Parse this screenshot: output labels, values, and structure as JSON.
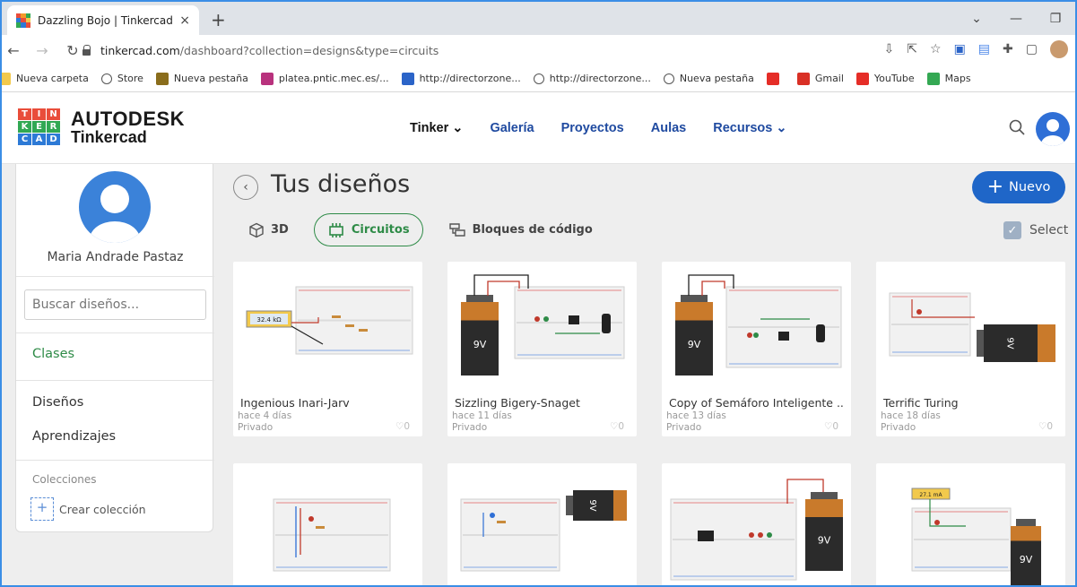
{
  "browser": {
    "tab_title": "Dazzling Bojo | Tinkercad",
    "tab_close": "×",
    "new_tab": "+",
    "url_host": "tinkercad.com",
    "url_path": "/dashboard?collection=designs&type=circuits",
    "bookmarks": [
      {
        "label": "Nueva carpeta",
        "icon": "folder-icon",
        "color": "#f2c94c"
      },
      {
        "label": "Store",
        "icon": "globe-icon",
        "color": "#555555"
      },
      {
        "label": "Nueva pestaña",
        "icon": "trophy-icon",
        "color": "#8a6d1c"
      },
      {
        "label": "platea.pntic.mec.es/...",
        "icon": "feather-icon",
        "color": "#b8327d"
      },
      {
        "label": "http://directorzone...",
        "icon": "dz-icon",
        "color": "#2b64c8"
      },
      {
        "label": "http://directorzone...",
        "icon": "globe-icon",
        "color": "#555555"
      },
      {
        "label": "Nueva pestaña",
        "icon": "globe-icon",
        "color": "#555555"
      },
      {
        "label": "",
        "icon": "youtube-icon",
        "color": "#e52d27"
      },
      {
        "label": "Gmail",
        "icon": "gmail-icon",
        "color": "#d93025"
      },
      {
        "label": "YouTube",
        "icon": "youtube-icon",
        "color": "#e52d27"
      },
      {
        "label": "Maps",
        "icon": "maps-icon",
        "color": "#34a853"
      }
    ]
  },
  "header": {
    "logo_line1": "AUTODESK",
    "logo_line2": "Tinkercad",
    "logo_letters": [
      "T",
      "I",
      "N",
      "K",
      "E",
      "R",
      "C",
      "A",
      "D"
    ],
    "nav": [
      "Tinker ⌄",
      "Galería",
      "Proyectos",
      "Aulas",
      "Recursos ⌄"
    ]
  },
  "sidebar": {
    "user_name": "Maria Andrade Pastaz",
    "search_placeholder": "Buscar diseños...",
    "clases": "Clases",
    "disenos": "Diseños",
    "aprendizajes": "Aprendizajes",
    "colecciones": "Colecciones",
    "crear_coleccion": "Crear colección",
    "plus": "+"
  },
  "main": {
    "back": "‹",
    "title": "Tus diseños",
    "new_label": "Nuevo",
    "new_plus": "+",
    "filters": [
      "3D",
      "Circuitos",
      "Bloques de código"
    ],
    "select_label": "Select",
    "cards": [
      {
        "name": "Ingenious Inari-Jarv",
        "date": "hace 4 días",
        "privacy": "Privado",
        "likes": "♡0",
        "readout": "32.4 kΩ"
      },
      {
        "name": "Sizzling Bigery-Snaget",
        "date": "hace 11 días",
        "privacy": "Privado",
        "likes": "♡0",
        "battery": "9V"
      },
      {
        "name": "Copy of Semáforo Inteligente ...",
        "date": "hace 13 días",
        "privacy": "Privado",
        "likes": "♡0",
        "battery": "9V"
      },
      {
        "name": "Terrific Turing",
        "date": "hace 18 días",
        "privacy": "Privado",
        "likes": "♡0",
        "battery": "9V"
      },
      {
        "name": "",
        "date": "",
        "privacy": "",
        "likes": ""
      },
      {
        "name": "",
        "date": "",
        "privacy": "",
        "likes": "",
        "battery": "9V"
      },
      {
        "name": "",
        "date": "",
        "privacy": "",
        "likes": "",
        "battery": "9V"
      },
      {
        "name": "",
        "date": "",
        "privacy": "",
        "likes": "",
        "battery": "9V",
        "readout": "27.1 mA"
      }
    ]
  },
  "colors": {
    "accent_blue": "#1f66c8",
    "green": "#2e8b47",
    "battery_top": "#c97a2b",
    "battery_body": "#2b2b2b"
  }
}
